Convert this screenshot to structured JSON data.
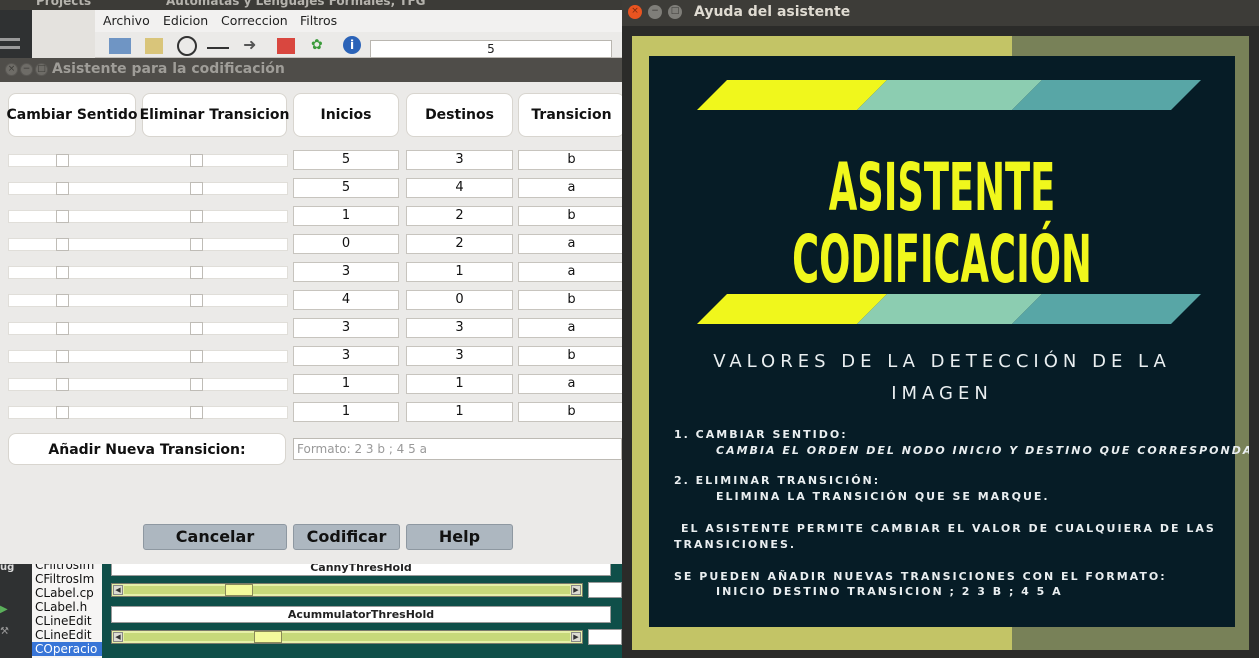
{
  "background_ide": {
    "titlebar_left": "Projects",
    "titlebar_text": "Automatas y Lenguajes Formales, TFG",
    "menu": [
      "Archivo",
      "Edicion",
      "Correccion",
      "Filtros"
    ],
    "spin_value": "5",
    "sidebar_label": "ug",
    "files": [
      "CFiltrosIm",
      "CFiltrosIm",
      "CLabel.cp",
      "CLabel.h",
      "CLineEdit",
      "CLineEdit",
      "COperacio"
    ],
    "sliders": [
      {
        "title": "CannyThresHold",
        "value": 0.24
      },
      {
        "title": "AcummulatorThresHold",
        "value": 0.31
      }
    ]
  },
  "wizard": {
    "title": "Asistente para la codificación",
    "headers": [
      "Cambiar Sentido",
      "Eliminar Transicion",
      "Inicios",
      "Destinos",
      "Transicion"
    ],
    "rows": [
      {
        "inicio": "5",
        "destino": "3",
        "transicion": "b"
      },
      {
        "inicio": "5",
        "destino": "4",
        "transicion": "a"
      },
      {
        "inicio": "1",
        "destino": "2",
        "transicion": "b"
      },
      {
        "inicio": "0",
        "destino": "2",
        "transicion": "a"
      },
      {
        "inicio": "3",
        "destino": "1",
        "transicion": "a"
      },
      {
        "inicio": "4",
        "destino": "0",
        "transicion": "b"
      },
      {
        "inicio": "3",
        "destino": "3",
        "transicion": "a"
      },
      {
        "inicio": "3",
        "destino": "3",
        "transicion": "b"
      },
      {
        "inicio": "1",
        "destino": "1",
        "transicion": "a"
      },
      {
        "inicio": "1",
        "destino": "1",
        "transicion": "b"
      }
    ],
    "add_label": "Añadir Nueva Transicion:",
    "add_placeholder": "Formato: 2 3 b ; 4 5 a",
    "buttons": {
      "cancel": "Cancelar",
      "encode": "Codificar",
      "help": "Help"
    }
  },
  "help": {
    "title": "Ayuda del asistente",
    "heading_line1": "ASISTENTE",
    "heading_line2": "CODIFICACIÓN",
    "subtitle_line1": "VALORES DE LA DETECCIÓN DE LA",
    "subtitle_line2": "IMAGEN",
    "item1_title": "1. CAMBIAR SENTIDO:",
    "item1_text": "CAMBIA EL ORDEN DEL NODO INICIO Y DESTINO QUE CORRESPONDA.",
    "item2_title": "2. ELIMINAR TRANSICIÓN:",
    "item2_text": "ELIMINA LA TRANSICIÓN QUE SE MARQUE.",
    "note1_line1": "EL ASISTENTE PERMITE CAMBIAR EL VALOR DE CUALQUIERA  DE LAS",
    "note1_line2": "TRANSICIONES.",
    "note2_line1": "SE PUEDEN AÑADIR NUEVAS TRANSICIONES CON EL FORMATO:",
    "note2_line2": "INICIO DESTINO TRANSICION ;  2 3 B ; 4 5 A",
    "colors": {
      "yellow": "#f0f71c",
      "teal_light": "#8ccdb1",
      "teal_dark": "#58a6a6",
      "navy": "#061c26",
      "olive": "#c3c466"
    }
  }
}
